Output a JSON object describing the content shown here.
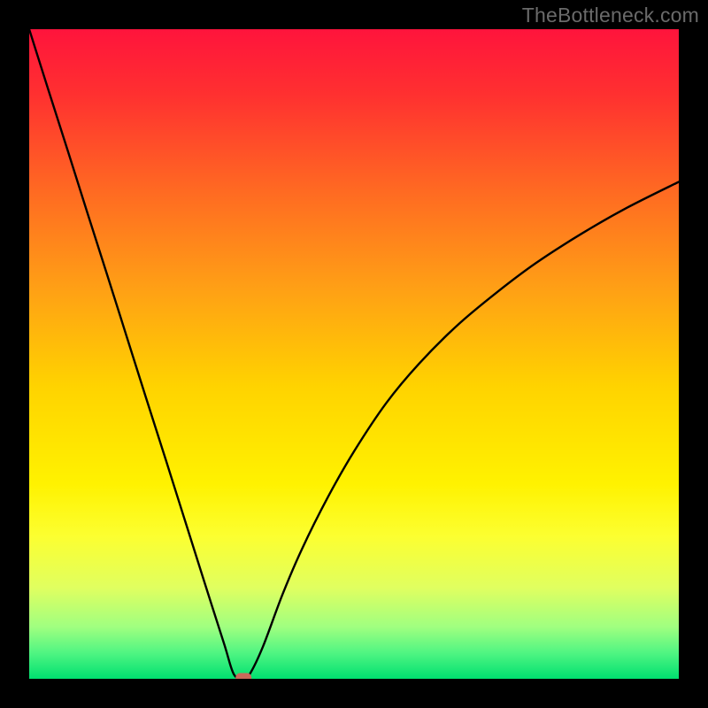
{
  "watermark": "TheBottleneck.com",
  "chart_data": {
    "type": "line",
    "title": "",
    "xlabel": "",
    "ylabel": "",
    "xlim": [
      0,
      100
    ],
    "ylim": [
      0,
      100
    ],
    "gradient_stops": [
      {
        "offset": 0.0,
        "color": "#ff143c"
      },
      {
        "offset": 0.1,
        "color": "#ff3030"
      },
      {
        "offset": 0.25,
        "color": "#ff6a22"
      },
      {
        "offset": 0.4,
        "color": "#ffa015"
      },
      {
        "offset": 0.55,
        "color": "#ffd300"
      },
      {
        "offset": 0.7,
        "color": "#fff200"
      },
      {
        "offset": 0.78,
        "color": "#fcff30"
      },
      {
        "offset": 0.86,
        "color": "#e0ff60"
      },
      {
        "offset": 0.92,
        "color": "#a0ff80"
      },
      {
        "offset": 0.96,
        "color": "#50f582"
      },
      {
        "offset": 1.0,
        "color": "#00e070"
      }
    ],
    "series": [
      {
        "name": "curve",
        "x": [
          0,
          3,
          6,
          9,
          12,
          15,
          18,
          21,
          24,
          27,
          30,
          31.5,
          33.0,
          34.0,
          36,
          39,
          42,
          46,
          50,
          55,
          60,
          66,
          72,
          78,
          85,
          92,
          100
        ],
        "y": [
          100,
          90.5,
          81.1,
          71.6,
          62.2,
          52.7,
          43.2,
          33.8,
          24.3,
          14.8,
          5.4,
          0.7,
          0.0,
          0.8,
          5.0,
          13.0,
          20.0,
          28.0,
          35.0,
          42.5,
          48.5,
          54.5,
          59.5,
          64.0,
          68.5,
          72.5,
          76.5
        ]
      }
    ],
    "marker": {
      "x": 33.0,
      "y": 0.2,
      "color": "#c96a5a"
    }
  }
}
